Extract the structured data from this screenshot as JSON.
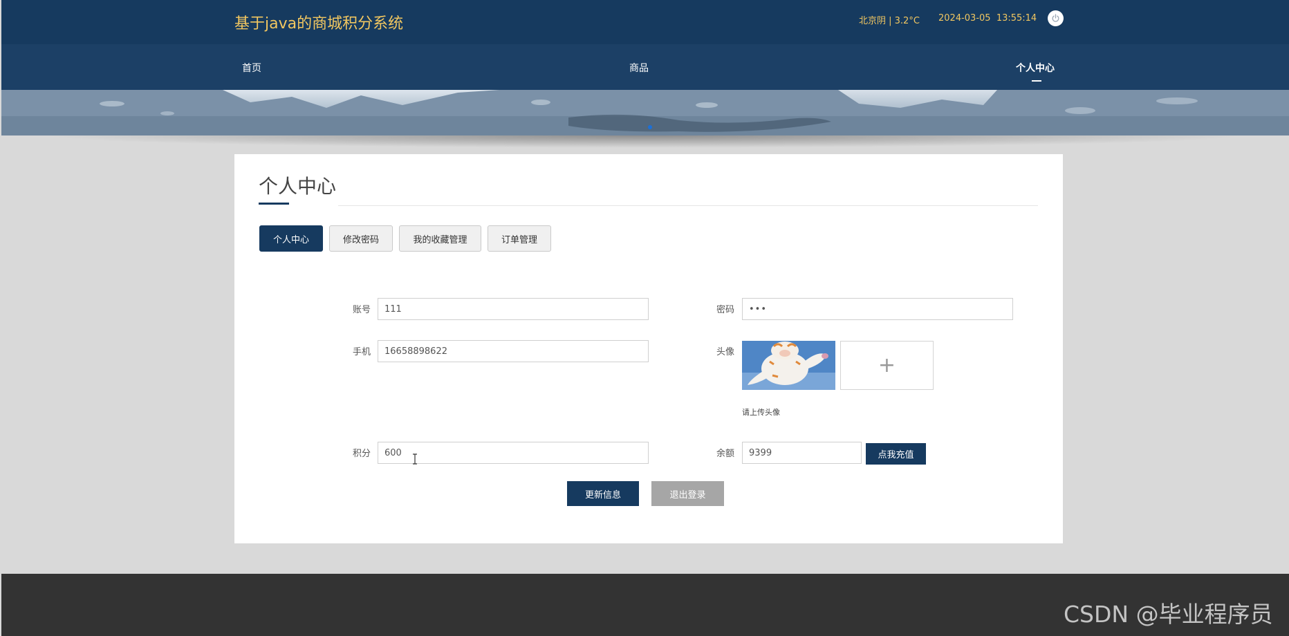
{
  "header": {
    "site_title": "基于java的商城积分系统",
    "weather": "北京阴 | 3.2°C",
    "datetime": "2024-03-05  13:55:14",
    "power_icon": "power-icon"
  },
  "nav": {
    "items": [
      {
        "label": "首页"
      },
      {
        "label": "商品"
      },
      {
        "label": "个人中心"
      }
    ],
    "active": "个人中心"
  },
  "page": {
    "title": "个人中心",
    "tabs": [
      {
        "label": "个人中心"
      },
      {
        "label": "修改密码"
      },
      {
        "label": "我的收藏管理"
      },
      {
        "label": "订单管理"
      }
    ]
  },
  "form": {
    "account": {
      "label": "账号",
      "value": "111"
    },
    "password": {
      "label": "密码",
      "value": "•••"
    },
    "phone": {
      "label": "手机",
      "value": "16658898622"
    },
    "avatar": {
      "label": "头像",
      "upload_symbol": "+",
      "tip": "请上传头像"
    },
    "points": {
      "label": "积分",
      "value": "600"
    },
    "balance": {
      "label": "余额",
      "value": "9399"
    },
    "recharge_label": "点我充值",
    "update_label": "更新信息",
    "logout_label": "退出登录"
  },
  "watermark": "CSDN @毕业程序员",
  "colors": {
    "primary": "#163a5f",
    "nav": "#1c4066",
    "title_gold": "#f2c760",
    "footer": "#333333",
    "page_bg": "#d9d9d9"
  }
}
